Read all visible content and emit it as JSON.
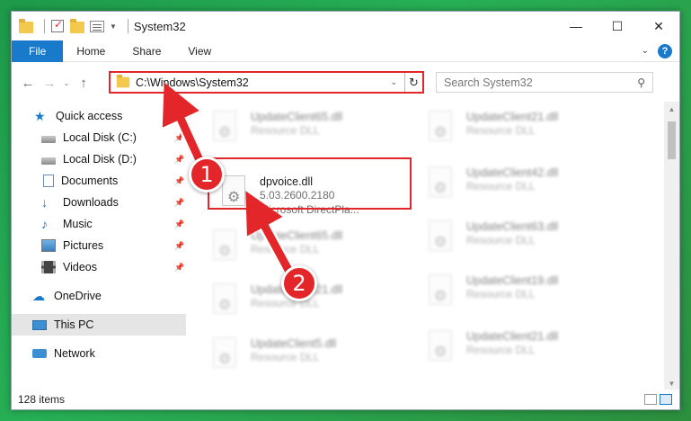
{
  "window": {
    "title": "System32",
    "controls": {
      "minimize": "—",
      "maximize": "☐",
      "close": "✕"
    }
  },
  "ribbon": {
    "tabs": [
      {
        "label": "File"
      },
      {
        "label": "Home"
      },
      {
        "label": "Share"
      },
      {
        "label": "View"
      }
    ],
    "help": "?"
  },
  "navbar": {
    "address": "C:\\Windows\\System32",
    "search_placeholder": "Search System32"
  },
  "sidebar": {
    "items": [
      {
        "label": "Quick access",
        "icon": "star-icon"
      },
      {
        "label": "Local Disk (C:)",
        "icon": "disk-icon",
        "pinned": true
      },
      {
        "label": "Local Disk (D:)",
        "icon": "disk-icon",
        "pinned": true
      },
      {
        "label": "Documents",
        "icon": "document-icon",
        "pinned": true
      },
      {
        "label": "Downloads",
        "icon": "download-icon",
        "pinned": true
      },
      {
        "label": "Music",
        "icon": "music-icon",
        "pinned": true
      },
      {
        "label": "Pictures",
        "icon": "pictures-icon",
        "pinned": true
      },
      {
        "label": "Videos",
        "icon": "videos-icon",
        "pinned": true
      },
      {
        "label": "OneDrive",
        "icon": "cloud-icon"
      },
      {
        "label": "This PC",
        "icon": "computer-icon",
        "selected": true
      },
      {
        "label": "Network",
        "icon": "network-icon"
      }
    ]
  },
  "files": {
    "left": [
      {
        "name": "UpdateClient65.dll",
        "meta1": "Resource DLL"
      },
      {
        "name": "dpvoice.dll",
        "meta1": "5.03.2600.2180",
        "meta2": "Microsoft DirectPla..."
      },
      {
        "name": "UpdateClient65.dll",
        "meta1": "Resource DLL"
      },
      {
        "name": "UpdateClient21.dll",
        "meta1": "Resource DLL"
      },
      {
        "name": "UpdateClient5.dll",
        "meta1": "Resource DLL"
      }
    ],
    "right": [
      {
        "name": "UpdateClient21.dll",
        "meta1": "Resource DLL"
      },
      {
        "name": "UpdateClient42.dll",
        "meta1": "Resource DLL"
      },
      {
        "name": "UpdateClient63.dll",
        "meta1": "Resource DLL"
      },
      {
        "name": "UpdateClient19.dll",
        "meta1": "Resource DLL"
      },
      {
        "name": "UpdateClient21.dll",
        "meta1": "Resource DLL"
      }
    ]
  },
  "status": {
    "count": "128 items"
  },
  "annotations": {
    "step1": "1",
    "step2": "2",
    "color": "#e2262a"
  }
}
